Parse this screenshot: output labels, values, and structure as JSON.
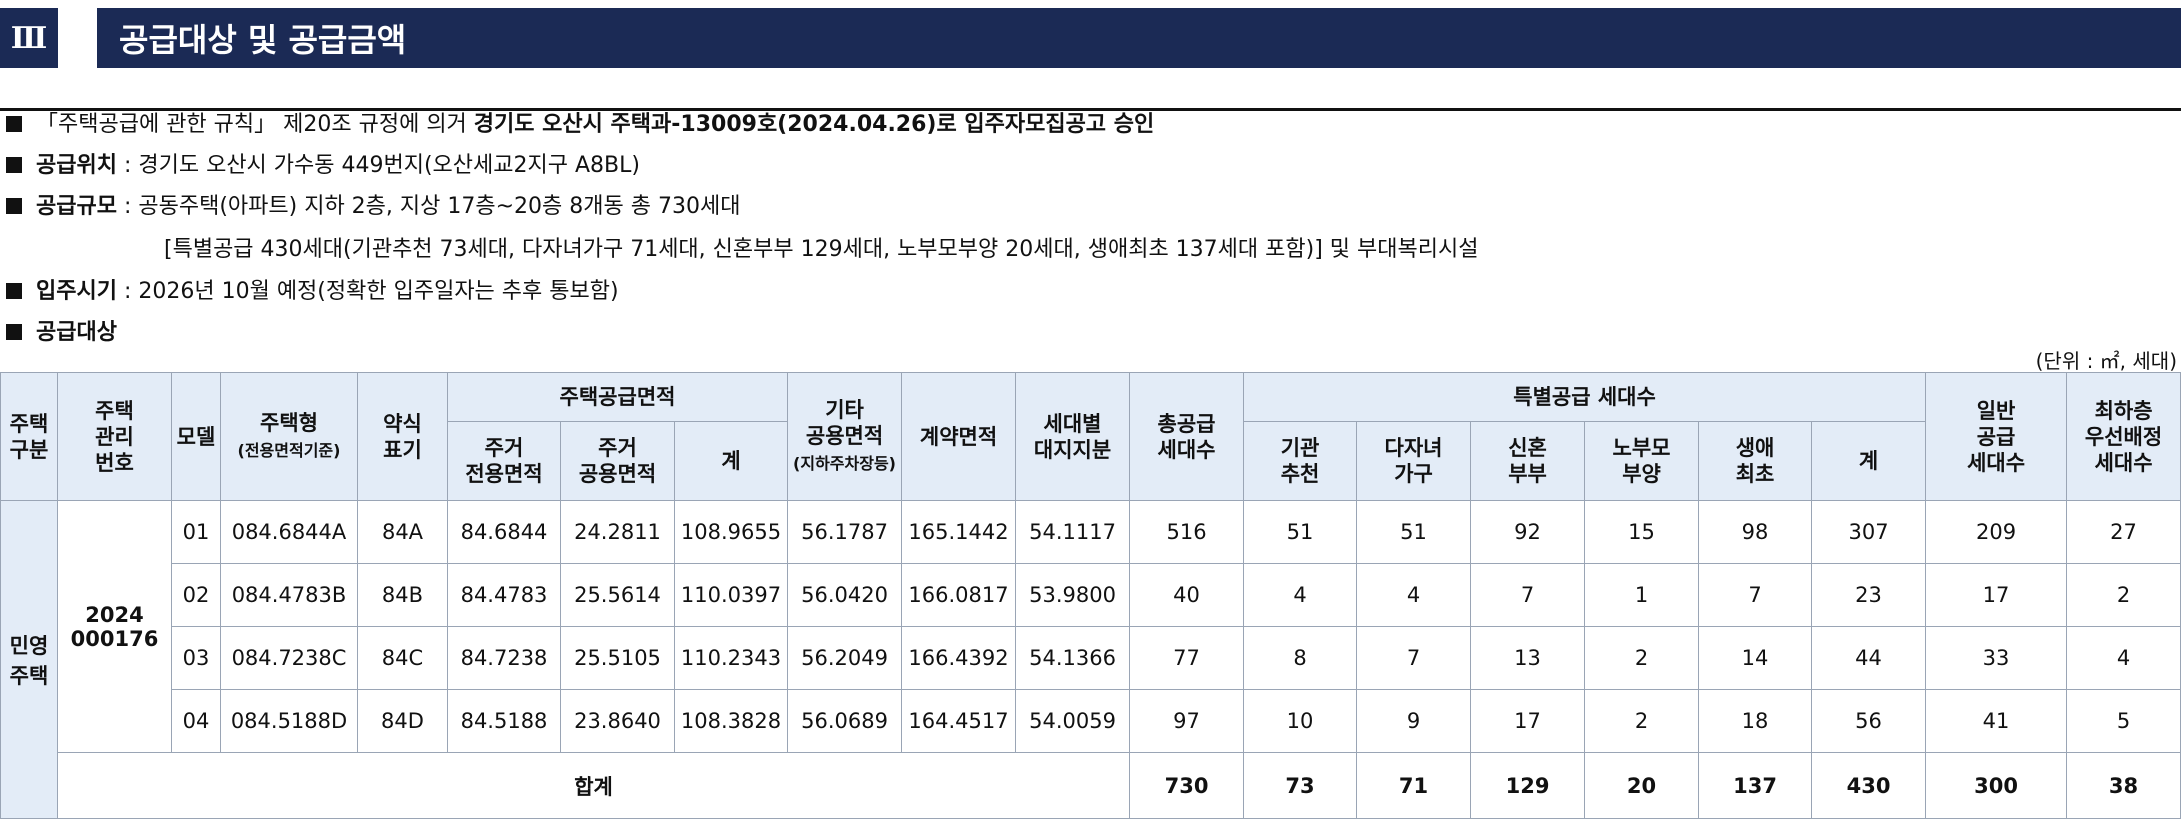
{
  "header": {
    "number": "Ⅲ",
    "title": "공급대상 및 공급금액"
  },
  "notice": {
    "l1_plain": "「주택공급에 관한 규칙」 제20조 규정에 의거 ",
    "l1_bold": "경기도 오산시 주택과-13009호(2024.04.26)로 입주자모집공고 승인",
    "l2_label": "공급위치",
    "l2_text": " : 경기도 오산시 가수동 449번지(오산세교2지구 A8BL)",
    "l3_label": "공급규모",
    "l3_text": " : 공동주택(아파트) 지하 2층, 지상 17층~20층 8개동 총 730세대",
    "l4_text": "[특별공급 430세대(기관추천 73세대, 다자녀가구 71세대, 신혼부부 129세대, 노부모부양 20세대, 생애최초 137세대 포함)] 및 부대복리시설",
    "l5_label": "입주시기",
    "l5_text": " : 2026년 10월 예정(정확한 입주일자는 추후 통보함)",
    "l6_label": "공급대상"
  },
  "unit_note": "(단위 : ㎡, 세대)",
  "table": {
    "h_type": "주택\n구분",
    "h_mgmt": "주택\n관리\n번호",
    "h_model": "모델",
    "h_housing_type": "주택형",
    "h_housing_type_sub": "(전용면적기준)",
    "h_abbr": "약식\n표기",
    "h_area_group": "주택공급면적",
    "h_excl": "주거\n전용면적",
    "h_common": "주거\n공용면적",
    "h_sum": "계",
    "h_other": "기타\n공용면적",
    "h_other_sub": "(지하주차장등)",
    "h_contract": "계약면적",
    "h_land": "세대별\n대지지분",
    "h_total_supply": "총공급\n세대수",
    "h_special_group": "특별공급 세대수",
    "h_inst": "기관\n추천",
    "h_multi": "다자녀\n가구",
    "h_newlywed": "신혼\n부부",
    "h_elder": "노부모\n부양",
    "h_first": "생애\n최초",
    "h_special_sum": "계",
    "h_general": "일반\n공급\n세대수",
    "h_lowest": "최하층\n우선배정\n세대수",
    "group_label": "민영\n주택",
    "mgmt_no": "2024\n000176",
    "rows": [
      {
        "model": "01",
        "type": "084.6844A",
        "abbr": "84A",
        "excl": "84.6844",
        "common": "24.2811",
        "sum": "108.9655",
        "other": "56.1787",
        "contract": "165.1442",
        "land": "54.1117",
        "total": "516",
        "inst": "51",
        "multi": "51",
        "newlywed": "92",
        "elder": "15",
        "first": "98",
        "special": "307",
        "general": "209",
        "lowest": "27"
      },
      {
        "model": "02",
        "type": "084.4783B",
        "abbr": "84B",
        "excl": "84.4783",
        "common": "25.5614",
        "sum": "110.0397",
        "other": "56.0420",
        "contract": "166.0817",
        "land": "53.9800",
        "total": "40",
        "inst": "4",
        "multi": "4",
        "newlywed": "7",
        "elder": "1",
        "first": "7",
        "special": "23",
        "general": "17",
        "lowest": "2"
      },
      {
        "model": "03",
        "type": "084.7238C",
        "abbr": "84C",
        "excl": "84.7238",
        "common": "25.5105",
        "sum": "110.2343",
        "other": "56.2049",
        "contract": "166.4392",
        "land": "54.1366",
        "total": "77",
        "inst": "8",
        "multi": "7",
        "newlywed": "13",
        "elder": "2",
        "first": "14",
        "special": "44",
        "general": "33",
        "lowest": "4"
      },
      {
        "model": "04",
        "type": "084.5188D",
        "abbr": "84D",
        "excl": "84.5188",
        "common": "23.8640",
        "sum": "108.3828",
        "other": "56.0689",
        "contract": "164.4517",
        "land": "54.0059",
        "total": "97",
        "inst": "10",
        "multi": "9",
        "newlywed": "17",
        "elder": "2",
        "first": "18",
        "special": "56",
        "general": "41",
        "lowest": "5"
      }
    ],
    "total": {
      "label": "합계",
      "total": "730",
      "inst": "73",
      "multi": "71",
      "newlywed": "129",
      "elder": "20",
      "first": "137",
      "special": "430",
      "general": "300",
      "lowest": "38"
    }
  }
}
